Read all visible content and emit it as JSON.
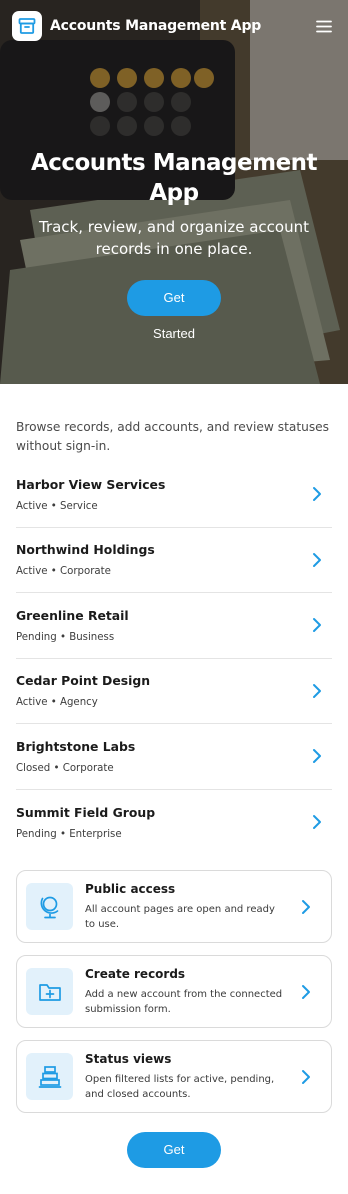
{
  "app": {
    "title": "Accounts Management App",
    "logo_icon": "archive-box-icon",
    "menu_icon": "hamburger-menu-icon"
  },
  "hero": {
    "title": "Accounts Management App",
    "subtitle": "Track, review, and organize account records in one place.",
    "cta_label": "Get Started",
    "background": "photo of calculator and stacked banknotes"
  },
  "intro": {
    "text": "Browse records, add accounts, and review statuses without sign-in."
  },
  "accounts": [
    {
      "name": "Harbor View Services",
      "meta": "Active • Service"
    },
    {
      "name": "Northwind Holdings",
      "meta": "Active • Corporate"
    },
    {
      "name": "Greenline Retail",
      "meta": "Pending • Business"
    },
    {
      "name": "Cedar Point Design",
      "meta": "Active • Agency"
    },
    {
      "name": "Brightstone Labs",
      "meta": "Closed • Corporate"
    },
    {
      "name": "Summit Field Group",
      "meta": "Pending • Enterprise"
    }
  ],
  "features": [
    {
      "title": "Public access",
      "desc": "All account pages are open and ready to use.",
      "icon": "globe-icon"
    },
    {
      "title": "Create records",
      "desc": "Add a new account from the connected submission form.",
      "icon": "folder-plus-icon"
    },
    {
      "title": "Status views",
      "desc": "Open filtered lists for active, pending, and closed accounts.",
      "icon": "stacked-trays-icon"
    }
  ],
  "bottom": {
    "cta_label": "Get Started"
  },
  "colors": {
    "accent": "#1e9be4",
    "icon_tile": "#e2f1fb",
    "border": "#dadada"
  }
}
